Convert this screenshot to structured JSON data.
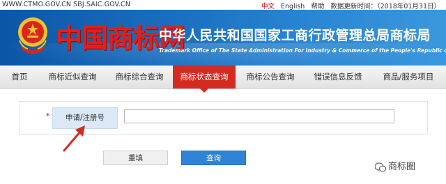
{
  "topbar": {
    "urls": "WWW.CTMO.GOV.CN SBJ.SAIC.GOV.CN",
    "lang_zh": "中文",
    "lang_en": "English",
    "help": "帮助",
    "update_time": "数据更新时间：（2018年01月31日）"
  },
  "header": {
    "logo_text": "中国商标网",
    "org_title": "中华人民共和国国家工商行政管理总局商标局",
    "org_subtitle": "Trademark Office of The State Administration For Industry & Commerce of the People's Republic of China"
  },
  "nav": {
    "items": [
      {
        "label": "首页"
      },
      {
        "label": "商标近似查询"
      },
      {
        "label": "商标综合查询"
      },
      {
        "label": "商标状态查询"
      },
      {
        "label": "商标公告查询"
      },
      {
        "label": "错误信息反馈"
      },
      {
        "label": "商品/服务项目"
      }
    ],
    "active": "商标状态查询"
  },
  "form": {
    "required_mark": "*",
    "field_label": "申请/注册号",
    "field_value": "",
    "reset_label": "重填",
    "search_label": "查询"
  },
  "watermark": "商标圈",
  "colors": {
    "banner": "#1a6fc0",
    "nav_active": "#d42b20",
    "search_button": "#2f83d6",
    "label_bg": "#dbe9f6"
  }
}
